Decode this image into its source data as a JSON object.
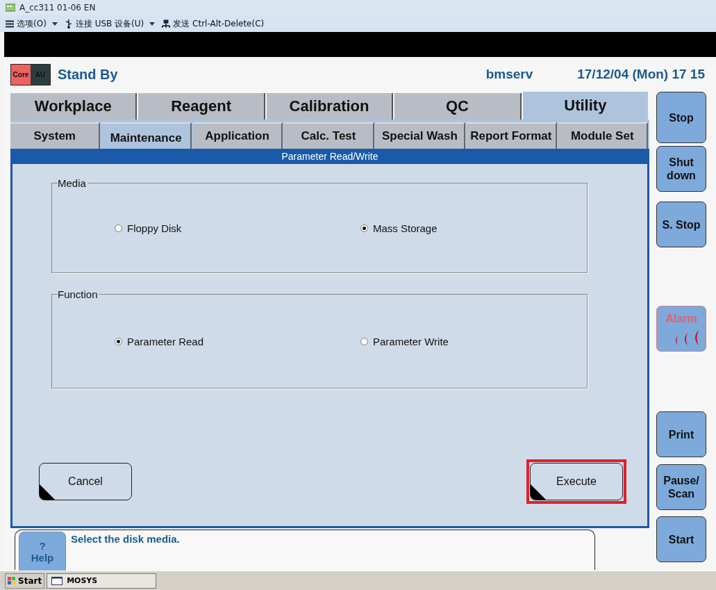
{
  "window": {
    "title": "A_cc311 01-06 EN"
  },
  "toolbar": [
    {
      "label": "选项(O)",
      "kind": "menu",
      "dropdown": true
    },
    {
      "label": "连接 USB 设备(U)",
      "kind": "usb",
      "dropdown": true
    },
    {
      "label": "发送 Ctrl-Alt-Delete(C)",
      "kind": "network",
      "dropdown": false
    }
  ],
  "header": {
    "badges": [
      {
        "label": "Core",
        "color": "#f06060"
      },
      {
        "label": "AU",
        "color": "#2a3e40"
      }
    ],
    "status": "Stand By",
    "user": "bmserv",
    "datetime": "17/12/04 (Mon) 17 15"
  },
  "main_tabs": [
    {
      "label": "Workplace",
      "selected": false
    },
    {
      "label": "Reagent",
      "selected": false
    },
    {
      "label": "Calibration",
      "selected": false
    },
    {
      "label": "QC",
      "selected": false
    },
    {
      "label": "Utility",
      "selected": true
    }
  ],
  "sub_tabs": [
    {
      "label": "System",
      "selected": false
    },
    {
      "label": "Maintenance",
      "selected": true
    },
    {
      "label": "Application",
      "selected": false
    },
    {
      "label": "Calc. Test",
      "selected": false
    },
    {
      "label": "Special Wash",
      "selected": false
    },
    {
      "label": "Report Format",
      "selected": false
    },
    {
      "label": "Module Set",
      "selected": false
    }
  ],
  "panel": {
    "title": "Parameter Read/Write",
    "groups": [
      {
        "title": "Media",
        "options": [
          {
            "label": "Floppy Disk",
            "selected": false
          },
          {
            "label": "Mass Storage",
            "selected": true
          }
        ]
      },
      {
        "title": "Function",
        "options": [
          {
            "label": "Parameter Read",
            "selected": true
          },
          {
            "label": "Parameter Write",
            "selected": false
          }
        ]
      }
    ],
    "buttons": [
      {
        "label": "Cancel",
        "highlighted": false
      },
      {
        "label": "Execute",
        "highlighted": true
      }
    ]
  },
  "side_buttons": [
    {
      "label": "Stop",
      "disabled": false
    },
    {
      "label": "Shut down",
      "disabled": false
    },
    {
      "label": "S. Stop",
      "disabled": false
    },
    {
      "label": "Alarm",
      "disabled": true,
      "kind": "alarm"
    },
    {
      "label": "Print",
      "disabled": false
    },
    {
      "label": "Pause/ Scan",
      "disabled": false
    },
    {
      "label": "Start",
      "disabled": false
    }
  ],
  "help": {
    "button": {
      "icon_text": "?",
      "label": "Help"
    },
    "message": "Select the disk media."
  },
  "taskbar": {
    "start": "Start",
    "tasks": [
      "MOSYS"
    ]
  }
}
